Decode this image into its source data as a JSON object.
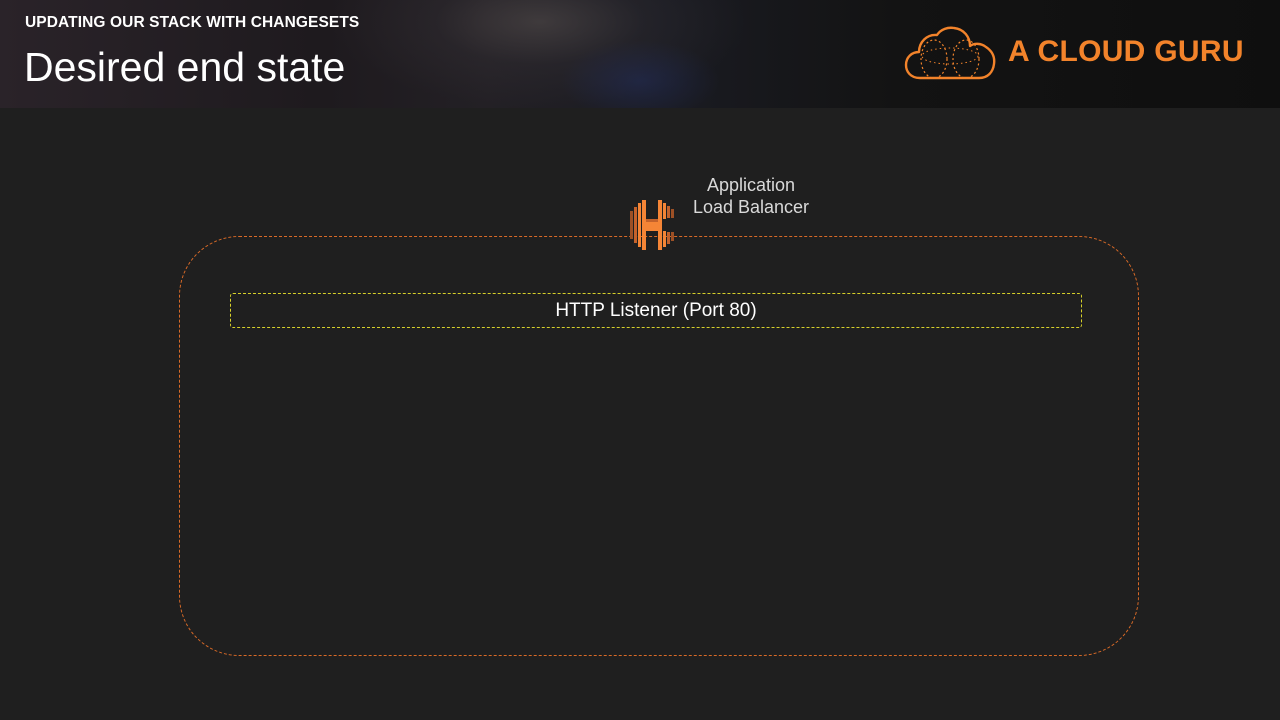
{
  "header": {
    "kicker": "UPDATING OUR STACK WITH CHANGESETS",
    "title": "Desired end state"
  },
  "logo": {
    "text": "A CLOUD GURU",
    "icon": "cloud-icon"
  },
  "diagram": {
    "load_balancer": {
      "icon": "elastic-load-balancing-icon",
      "label_line1": "Application",
      "label_line2": "Load Balancer"
    },
    "listener": {
      "label": "HTTP Listener (Port 80)"
    }
  },
  "colors": {
    "background": "#1f1f1f",
    "brand_orange": "#f2832b",
    "alb_border": "#d96a27",
    "listener_border": "#d6d02a",
    "aws_orange_light": "#f58536",
    "aws_orange_dark": "#9d5025"
  }
}
